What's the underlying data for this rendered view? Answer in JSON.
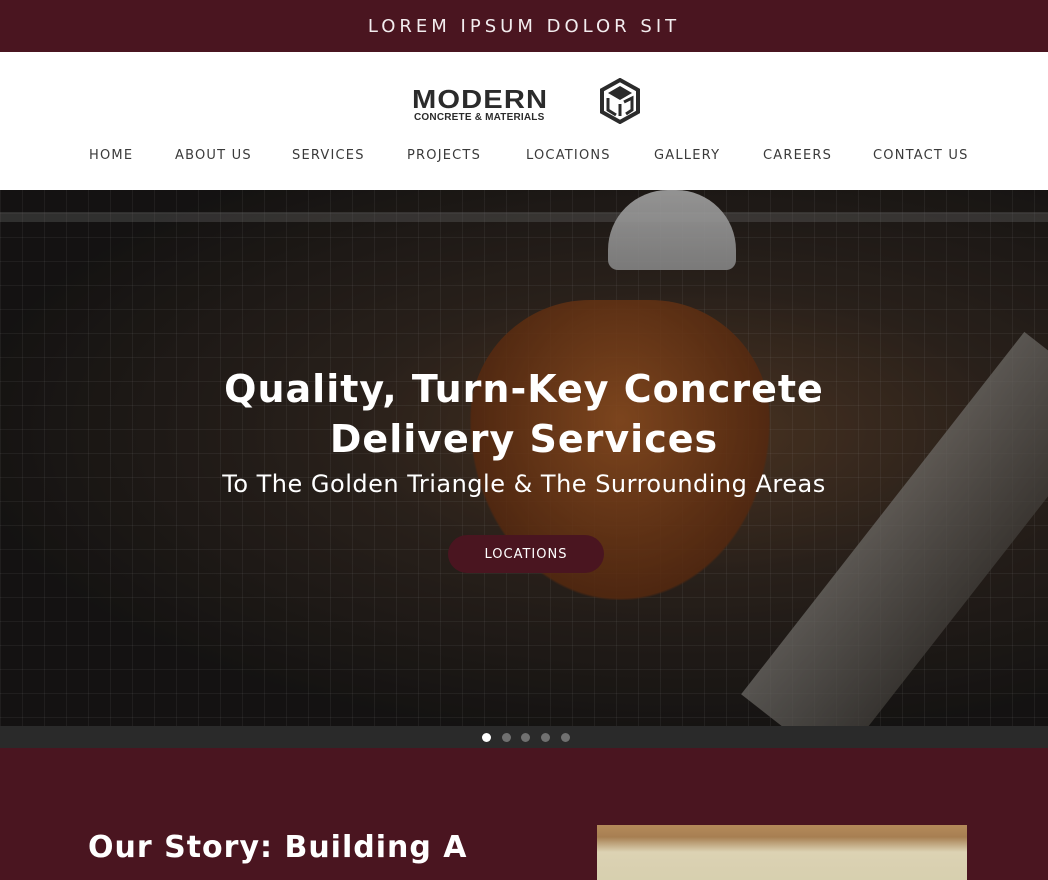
{
  "announcement": {
    "text": "LOREM IPSUM DOLOR SIT"
  },
  "header": {
    "logo": {
      "name": "MODERN",
      "tagline": "CONCRETE & MATERIALS",
      "icon": "cube-logo-icon"
    },
    "nav": [
      {
        "label": "HOME"
      },
      {
        "label": "ABOUT US"
      },
      {
        "label": "SERVICES"
      },
      {
        "label": "PROJECTS"
      },
      {
        "label": "LOCATIONS"
      },
      {
        "label": "GALLERY"
      },
      {
        "label": "CAREERS"
      },
      {
        "label": "CONTACT US"
      }
    ]
  },
  "hero": {
    "title_line1": "Quality, Turn-Key Concrete",
    "title_line2": "Delivery Services",
    "subtitle": "To The Golden Triangle & The Surrounding Areas",
    "cta_label": "LOCATIONS",
    "slides": {
      "count": 5,
      "active": 1
    }
  },
  "story": {
    "title": "Our Story: Building A"
  },
  "colors": {
    "brand": "#4a1520",
    "nav_text": "#3a3a3a",
    "white": "#ffffff"
  }
}
